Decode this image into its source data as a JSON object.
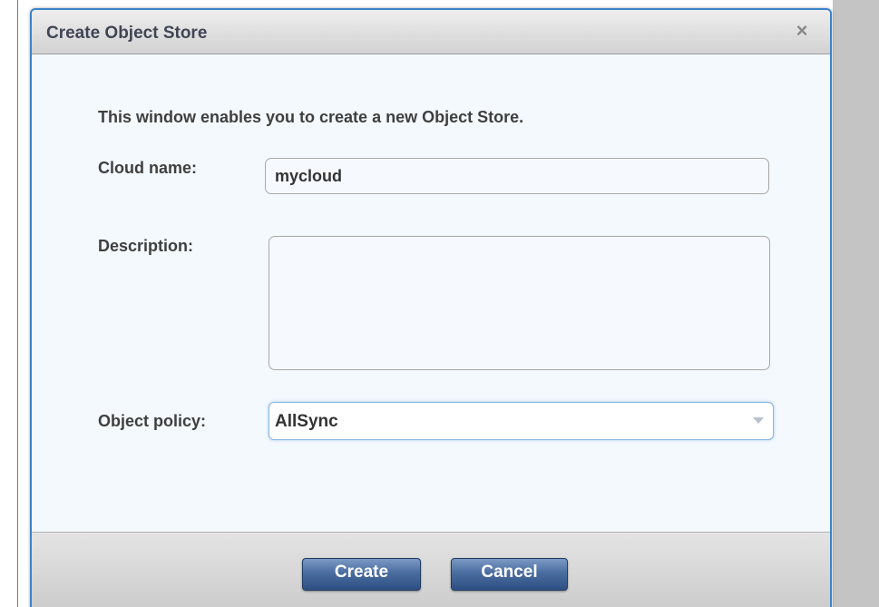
{
  "dialog": {
    "title": "Create Object Store",
    "close_icon": "close-icon",
    "close_glyph": "×"
  },
  "form": {
    "intro": "This window enables you to create a new Object Store.",
    "cloud_name_label": "Cloud name:",
    "cloud_name_value": "mycloud",
    "description_label": "Description:",
    "description_value": "",
    "object_policy_label": "Object policy:",
    "object_policy_value": "AllSync"
  },
  "buttons": {
    "create_label": "Create",
    "cancel_label": "Cancel"
  },
  "colors": {
    "dialog_border": "#3a83c9",
    "button_blue": "#4a6da0",
    "dialog_background": "#f4f9fe"
  }
}
